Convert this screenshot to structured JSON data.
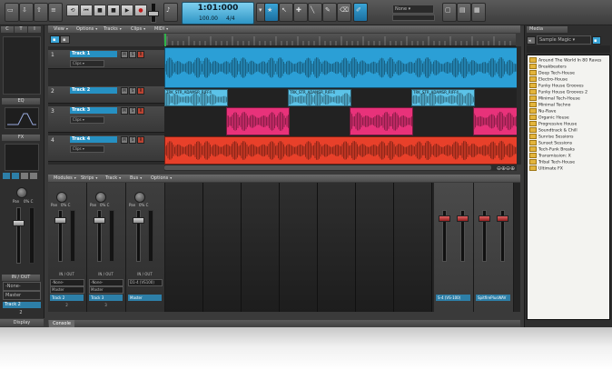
{
  "toolbar": {
    "transport_time": "1:01:000",
    "tempo": "100.00",
    "meter": "4/4",
    "snap_select": "None",
    "icons": [
      "new-project-icon",
      "open-icon",
      "save-icon",
      "mixer-icon",
      "loop-icon",
      "rewind-start-icon",
      "rewind-icon",
      "stop-icon",
      "play-icon",
      "forward-icon",
      "record-icon",
      "metronome-icon",
      "smart-tool-icon",
      "move-tool-icon",
      "edit-tool-icon",
      "draw-tool-icon",
      "erase-tool-icon",
      "automation-icon",
      "layout-icon",
      "browser-icon",
      "settings-icon"
    ]
  },
  "inspector": {
    "tabs": [
      "C",
      "T",
      "I"
    ],
    "eq_label": "EQ",
    "fx_label": "FX",
    "pan_label": "Pan",
    "pan_value": "0% C",
    "io_label": "IN / OUT",
    "input_route": "-None-",
    "output_route": "Master",
    "track_name": "Track 2",
    "track_number": "2",
    "display_label": "Display"
  },
  "arranger": {
    "menus": [
      "View",
      "Options",
      "Tracks",
      "Clips",
      "MIDI"
    ],
    "tracks": [
      {
        "number": "1",
        "name": "Track 1",
        "clip_select": "Clips"
      },
      {
        "number": "2",
        "name": "Track 2",
        "clip_select": "Clips"
      },
      {
        "number": "3",
        "name": "Track 3",
        "clip_select": "Clips"
      },
      {
        "number": "4",
        "name": "Track 4",
        "clip_select": "Clips"
      }
    ],
    "track_buttons": [
      "M",
      "S",
      "R"
    ],
    "clip_name": "TRK_STR_ADAMSR_RIFF4"
  },
  "console": {
    "menus": [
      "Modules",
      "Strips",
      "Track",
      "Bus",
      "Options"
    ],
    "pan_label": "Pan",
    "pan_value": "0% C",
    "io_label": "IN / OUT",
    "strips": [
      {
        "input": "-None-",
        "output": "Master",
        "name": "Track 2",
        "number": "2",
        "color": "#2d7fa8"
      },
      {
        "input": "-None-",
        "output": "Master",
        "name": "Track 3",
        "number": "3",
        "color": "#2d7fa8"
      },
      {
        "input": "D1-4 (VS100)",
        "output": "",
        "name": "Master",
        "number": "",
        "color": "#2d7fa8"
      }
    ],
    "right_strips": [
      {
        "name": "S-4 (VS-100)",
        "number": ""
      },
      {
        "name": "SpitfirePlusWAV",
        "number": ""
      }
    ],
    "bottom_label": "Console"
  },
  "media": {
    "tab_label": "Media",
    "dropdown": "Sample Magic",
    "items": [
      "Around The World In 80 Raves",
      "Breakbeaters",
      "Deep Tech-House",
      "Electro-House",
      "Funky House Grooves",
      "Funky House Grooves 2",
      "Minimal Tech-House",
      "Minimal Techno",
      "Nu-Rave",
      "Organic House",
      "Progressive House",
      "Soundtrack & Chill",
      "Sunrise Sessions",
      "Sunset Sessions",
      "Tech-Funk Breaks",
      "Transmission: X",
      "Tribal Tech-House",
      "Ultimate FX"
    ]
  },
  "colors": {
    "track1": "#2b9fd6",
    "track2": "#5cc3e8",
    "track3": "#e8327a",
    "track4": "#e8402a",
    "lcd": "#4fb4df"
  }
}
